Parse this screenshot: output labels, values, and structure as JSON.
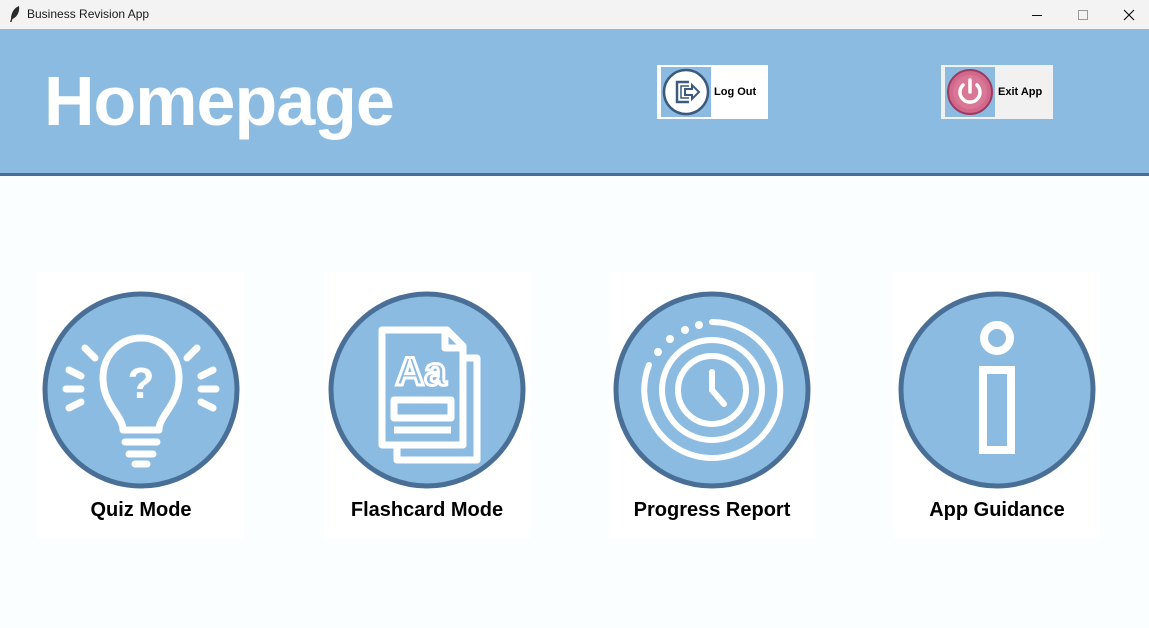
{
  "window": {
    "title": "Business Revision App",
    "app_icon": "feather-icon",
    "controls": [
      "minimize-icon",
      "maximize-icon",
      "close-icon"
    ]
  },
  "header": {
    "title": "Homepage",
    "background": "#8bbbe1",
    "logout": {
      "label": "Log Out",
      "icon": "logout-icon"
    },
    "exit": {
      "label": "Exit App",
      "icon": "power-icon"
    }
  },
  "cards": [
    {
      "label": "Quiz Mode",
      "icon": "lightbulb-question-icon"
    },
    {
      "label": "Flashcard Mode",
      "icon": "flashcard-icon"
    },
    {
      "label": "Progress Report",
      "icon": "clock-icon"
    },
    {
      "label": "App Guidance",
      "icon": "info-icon"
    }
  ],
  "colors": {
    "accent": "#8bbbe1",
    "circle_border": "#4a6f96",
    "background": "#fbfeff"
  }
}
